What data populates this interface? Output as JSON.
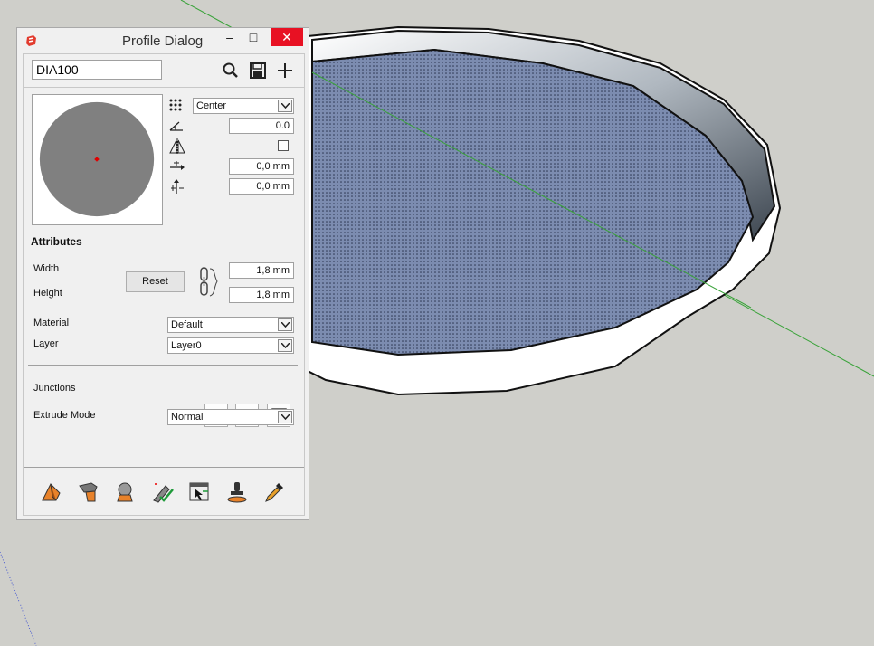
{
  "dialog": {
    "title": "Profile Dialog",
    "minimize": "–",
    "maximize": "□",
    "close": "✕",
    "profile_name": "DIA100",
    "toolbar_icons": [
      "search-icon",
      "save-icon",
      "add-icon"
    ]
  },
  "placement": {
    "anchor": "Center",
    "rotation": "0.0",
    "mirror_checked": false,
    "offset_x": "0,0 mm",
    "offset_y": "0,0 mm"
  },
  "attributes": {
    "heading": "Attributes",
    "width_label": "Width",
    "height_label": "Height",
    "reset_label": "Reset",
    "width_value": "1,8 mm",
    "height_value": "1,8 mm",
    "material_label": "Material",
    "material_value": "Default",
    "layer_label": "Layer",
    "layer_value": "Layer0",
    "junctions_label": "Junctions",
    "extrude_label": "Extrude Mode",
    "extrude_value": "Normal"
  },
  "bottom_tools": [
    "extrude-profile-icon",
    "paint-profile-icon",
    "profile-sphere-icon",
    "check-path-icon",
    "select-edges-icon",
    "stamp-icon",
    "eyedropper-icon"
  ],
  "colors": {
    "close_red": "#e81123",
    "profile_gray": "#808080",
    "center_dot": "#e00000",
    "face_blue": "#6d7fa5",
    "axis_green": "#3aa33a"
  }
}
